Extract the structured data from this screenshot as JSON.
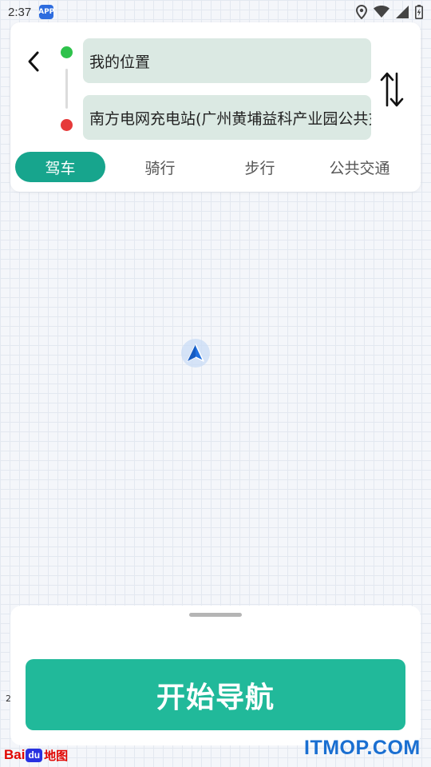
{
  "status_bar": {
    "time": "2:37",
    "app_badge": "APP",
    "icons": [
      "location-icon",
      "wifi-icon",
      "cellular-signal-icon",
      "battery-icon"
    ]
  },
  "route": {
    "origin": "我的位置",
    "destination": "南方电网充电站(广州黄埔益科产业园公共充电站)",
    "origin_color": "#2ec24b",
    "destination_color": "#e63a3a"
  },
  "modes": {
    "tabs": [
      {
        "label": "驾车",
        "active": true
      },
      {
        "label": "骑行",
        "active": false
      },
      {
        "label": "步行",
        "active": false
      },
      {
        "label": "公共交通",
        "active": false
      }
    ],
    "active_color": "#17a58d"
  },
  "navigation": {
    "start_button_label": "开始导航",
    "button_color": "#21b99a"
  },
  "map": {
    "scale_label": "2",
    "logo": {
      "prefix": "Bai",
      "paw": "du",
      "suffix": "地图"
    }
  },
  "watermark": "ITMOP.COM"
}
